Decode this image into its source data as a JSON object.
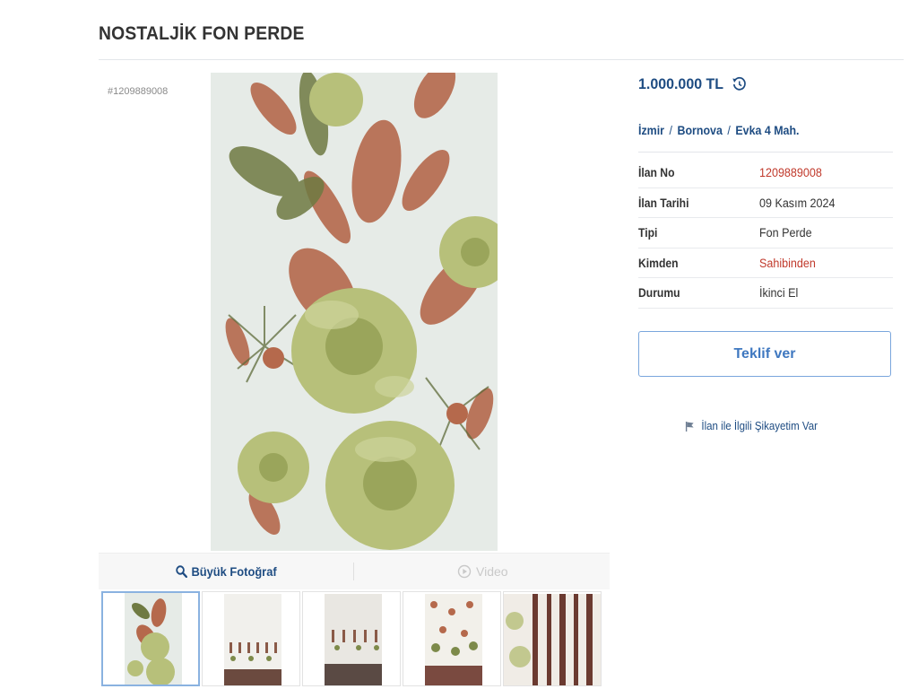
{
  "header": {
    "title": "NOSTALJİK FON PERDE"
  },
  "gallery": {
    "listing_ref": "#1209889008",
    "big_photo_label": "Büyük Fotoğraf",
    "video_label": "Video",
    "thumbnail_count": 5
  },
  "details": {
    "price": "1.000.000 TL",
    "location": {
      "city": "İzmir",
      "district": "Bornova",
      "neighborhood": "Evka 4 Mah."
    },
    "rows": [
      {
        "key": "İlan No",
        "value": "1209889008"
      },
      {
        "key": "İlan Tarihi",
        "value": "09 Kasım 2024"
      },
      {
        "key": "Tipi",
        "value": "Fon Perde"
      },
      {
        "key": "Kimden",
        "value": "Sahibinden"
      },
      {
        "key": "Durumu",
        "value": "İkinci El"
      }
    ],
    "offer_button": "Teklif ver",
    "complaint_link": "İlan ile İlgili Şikayetim Var"
  },
  "colors": {
    "brand_blue": "#1e4c82",
    "button_blue": "#3f78c0",
    "highlight_red": "#c0392b",
    "leaf_rust": "#b5694c",
    "leaf_green": "#a7b46a"
  },
  "icons": {
    "price_history": "history-icon",
    "search": "magnifier-icon",
    "video": "play-circle-icon",
    "complaint": "flag-icon"
  }
}
